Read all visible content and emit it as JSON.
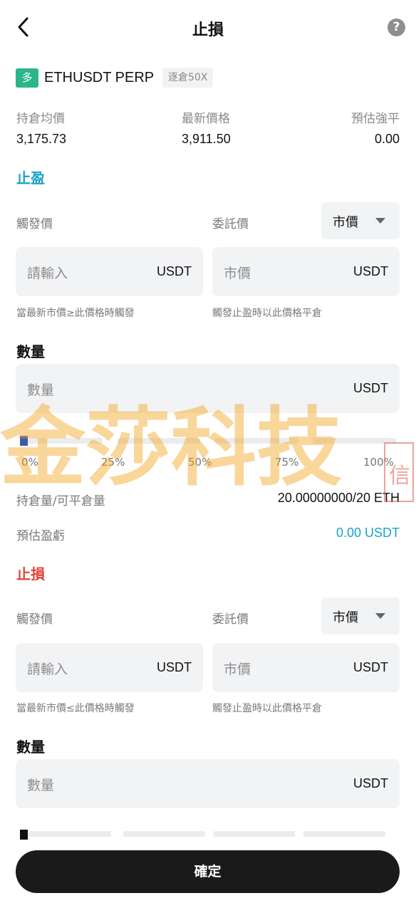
{
  "header": {
    "title": "止損"
  },
  "position": {
    "side_badge": "多",
    "symbol": "ETHUSDT PERP",
    "margin_tag": "逐倉50X"
  },
  "stats": [
    {
      "label": "持倉均價",
      "value": "3,175.73"
    },
    {
      "label": "最新價格",
      "value": "3,911.50"
    },
    {
      "label": "預估強平",
      "value": "0.00"
    }
  ],
  "take_profit": {
    "title": "止盈",
    "trigger_label": "觸發價",
    "order_label": "委託價",
    "order_type": "市價",
    "trigger_input": {
      "placeholder": "請輸入",
      "unit": "USDT"
    },
    "order_input": {
      "placeholder": "市價",
      "unit": "USDT"
    },
    "trigger_hint": "當最新市價≥此價格時觸發",
    "order_hint": "觸發止盈時以此價格平倉",
    "qty_title": "數量",
    "qty_input": {
      "placeholder": "數量",
      "unit": "USDT"
    },
    "slider_marks": [
      "0%",
      "25%",
      "50%",
      "75%",
      "100%"
    ],
    "slider_value_percent": 0,
    "closable_label": "持倉量/可平倉量",
    "closable_value": "20.00000000/20 ETH",
    "pnl_label": "預估盈虧",
    "pnl_value": "0.00 USDT"
  },
  "stop_loss": {
    "title": "止損",
    "trigger_label": "觸發價",
    "order_label": "委託價",
    "order_type": "市價",
    "trigger_input": {
      "placeholder": "請輸入",
      "unit": "USDT"
    },
    "order_input": {
      "placeholder": "市價",
      "unit": "USDT"
    },
    "trigger_hint": "當最新市價≤此價格時觸發",
    "order_hint": "觸發止盈時以此價格平倉",
    "qty_title": "數量",
    "qty_input": {
      "placeholder": "數量",
      "unit": "USDT"
    },
    "slider_value_percent": 0
  },
  "confirm_label": "確定",
  "watermark": {
    "text": "金莎科技",
    "seal": "信"
  },
  "colors": {
    "teal": "#1ba2c6",
    "red": "#e0453a",
    "green": "#2cb58a",
    "button": "#1a1a1a"
  }
}
